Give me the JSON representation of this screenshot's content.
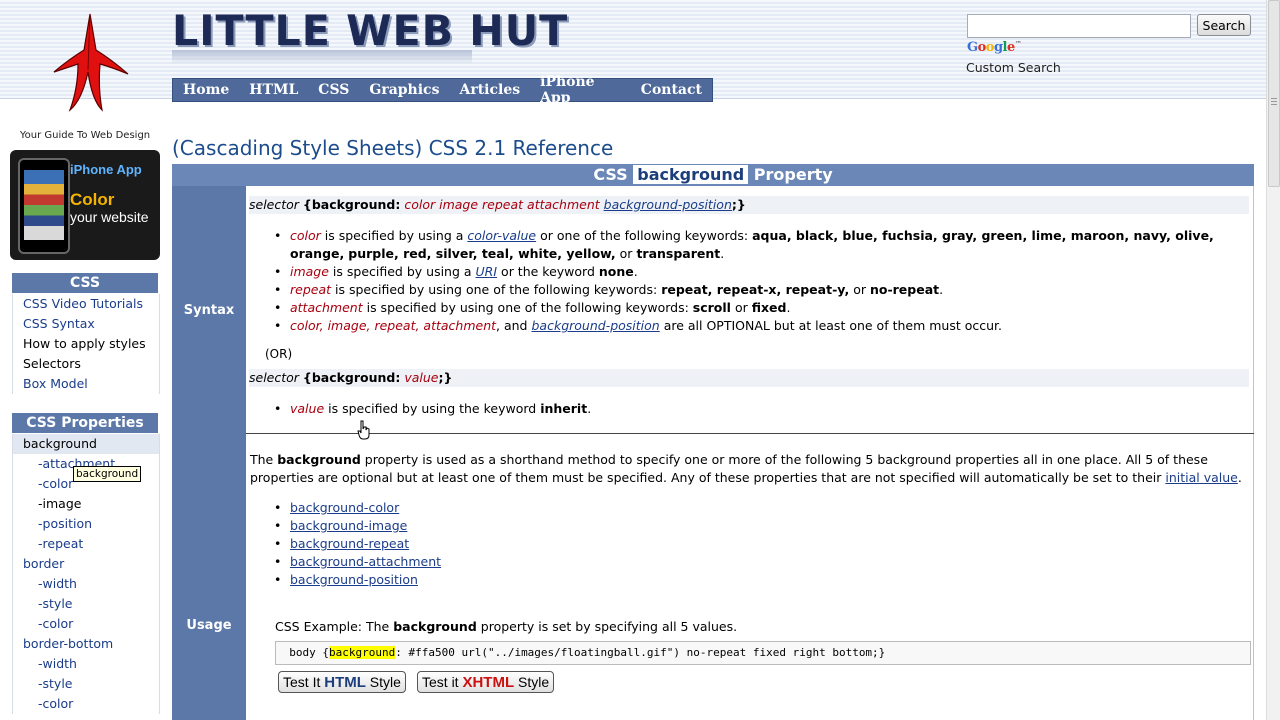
{
  "header": {
    "site_title": "LITTLE WEB HUT",
    "tagline": "Your Guide To Web Design",
    "search_button": "Search",
    "search_value": "",
    "google_brand": "Google",
    "google_tm": "™",
    "custom_search": "Custom Search"
  },
  "nav": {
    "items": [
      "Home",
      "HTML",
      "CSS",
      "Graphics",
      "Articles",
      "iPhone App",
      "Contact"
    ]
  },
  "promo": {
    "line1": "iPhone App",
    "line2": "Color",
    "line3": "your website"
  },
  "sidebar": {
    "css_heading": "CSS",
    "css_items": [
      "CSS Video Tutorials",
      "CSS Syntax",
      "How to apply styles",
      "Selectors",
      "Box Model"
    ],
    "props_heading": "CSS Properties",
    "prop_items": [
      "background",
      "-attachment",
      "-color",
      "-image",
      "-position",
      "-repeat",
      "border",
      "-width",
      "-style",
      "-color",
      "border-bottom",
      "-width",
      "-style",
      "-color"
    ],
    "tooltip": "background"
  },
  "main": {
    "page_title": "(Cascading Style Sheets) CSS 2.1 Reference",
    "prop_head_pre": "CSS",
    "prop_head_name": "background",
    "prop_head_post": "Property",
    "syntax_label": "Syntax",
    "usage_label": "Usage",
    "syntax": {
      "l1_selector": "selector",
      "l1_open": "{background:",
      "l1_color": "color",
      "l1_image": "image",
      "l1_repeat": "repeat",
      "l1_attachment": "attachment",
      "l1_position": "background-position",
      "l1_close": ";}",
      "b1_term": "color",
      "b1_t1": "is specified by using a",
      "b1_link": "color-value",
      "b1_t2": "or one of the following keywords:",
      "b1_kw1": "aqua, black, blue, fuchsia, gray, green, lime, maroon, navy, olive, orange,",
      "b1_kw2": "purple, red, silver, teal, white, yellow,",
      "b1_or": "or",
      "b1_kw3": "transparent",
      "b1_end": ".",
      "b2_term": "image",
      "b2_t1": "is specified by using a",
      "b2_link": "URI",
      "b2_t2": "or the keyword",
      "b2_kw": "none",
      "b2_end": ".",
      "b3_term": "repeat",
      "b3_t1": "is specified by using one of the following keywords:",
      "b3_kw": "repeat, repeat-x, repeat-y,",
      "b3_or": "or",
      "b3_kw2": "no-repeat",
      "b3_end": ".",
      "b4_term": "attachment",
      "b4_t1": "is specified by using one of the following keywords:",
      "b4_kw": "scroll",
      "b4_or": "or",
      "b4_kw2": "fixed",
      "b4_end": ".",
      "b5_terms": "color, image, repeat, attachment",
      "b5_and": ", and",
      "b5_link": "background-position",
      "b5_t1": "are all OPTIONAL but at least one of them must occur.",
      "or": "(OR)",
      "l2_selector": "selector",
      "l2_open": "{background:",
      "l2_value": "value",
      "l2_close": ";}",
      "b6_term": "value",
      "b6_t1": "is specified by using the keyword",
      "b6_kw": "inherit",
      "b6_end": "."
    },
    "usage": {
      "p_the": "The",
      "p_kw": "background",
      "p_t1": "property is used as a shorthand method to specify one or more of the following 5 background properties all in one place. All 5 of these properties are optional but at least one of them must be specified. Any of these properties that are not specified will automatically be set to their",
      "p_link": "initial value",
      "p_end": ".",
      "links": [
        "background-color",
        "background-image",
        "background-repeat",
        "background-attachment",
        "background-position"
      ],
      "ex_pre": "CSS Example: The",
      "ex_kw": "background",
      "ex_post": "property is set by specifying all 5 values.",
      "code_pre": "body {",
      "code_hl": "background",
      "code_post": ": #ffa500 url(\"../images/floatingball.gif\") no-repeat fixed right bottom;}",
      "btn1_pre": "Test It",
      "btn1_bold": "HTML",
      "btn1_post": "Style",
      "btn2_pre": "Test it",
      "btn2_bold": "XHTML",
      "btn2_post": "Style"
    }
  },
  "colors": {
    "nav_bg": "#4f6a9a",
    "label_col": "#5b78a8",
    "accent_red": "#a8000e",
    "link": "#1a3c8a",
    "xhtml_red": "#cc1111",
    "html_blue": "#1c3e7a"
  }
}
